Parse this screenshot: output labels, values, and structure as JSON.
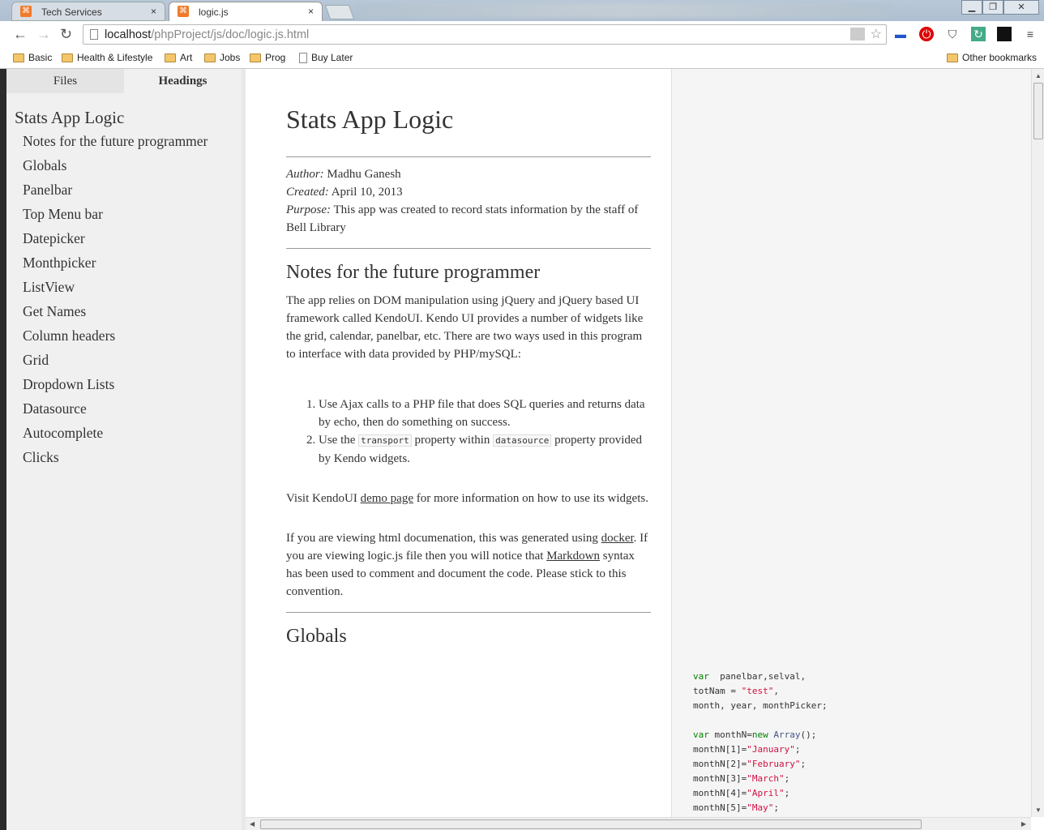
{
  "browser": {
    "tabs": [
      {
        "label": "Tech Services",
        "close": "×"
      },
      {
        "label": "logic.js",
        "close": "×"
      }
    ],
    "url_host": "localhost",
    "url_path": "/phpProject/js/doc/logic.js.html",
    "bookmarks": [
      "Basic",
      "Health & Lifestyle",
      "Art",
      "Jobs",
      "Prog",
      "Buy Later"
    ],
    "other_bookmarks": "Other bookmarks"
  },
  "sidebar": {
    "tabs": [
      "Files",
      "Headings"
    ],
    "title": "Stats App Logic",
    "items": [
      "Notes for the future programmer",
      "Globals",
      "Panelbar",
      "Top Menu bar",
      "Datepicker",
      "Monthpicker",
      "ListView",
      "Get Names",
      "Column headers",
      "Grid",
      "Dropdown Lists",
      "Datasource",
      "Autocomplete",
      "Clicks"
    ]
  },
  "doc": {
    "title": "Stats App Logic",
    "author_label": "Author:",
    "author": "Madhu Ganesh",
    "created_label": "Created:",
    "created": "April 10, 2013",
    "purpose_label": "Purpose:",
    "purpose": "This app was created to record stats information by the staff of Bell Library",
    "h_notes": "Notes for the future programmer",
    "notes_p": "The app relies on DOM manipulation using jQuery and jQuery based UI framework called KendoUI. Kendo UI provides a number of widgets like the grid, calendar, panelbar, etc. There are two ways used in this program to interface with data provided by PHP/mySQL:",
    "li1": "Use Ajax calls to a PHP file that does SQL queries and returns data by echo, then do something on success.",
    "li2_a": "Use the ",
    "li2_code1": "transport",
    "li2_b": " property within ",
    "li2_code2": "datasource",
    "li2_c": " property provided by Kendo widgets.",
    "visit_a": "Visit KendoUI ",
    "visit_link": "demo page",
    "visit_b": " for more information on how to use its widgets.",
    "view_a": "If you are viewing html documenation, this was generated using ",
    "view_link1": "docker",
    "view_b": ". If you are viewing logic.js file then you will notice that ",
    "view_link2": "Markdown",
    "view_c": " syntax has been used to comment and document the code. Please stick to this convention.",
    "h_globals": "Globals"
  },
  "code": {
    "lines": [
      [
        [
          "kw",
          "var"
        ],
        [
          "",
          "  panelbar,selval,"
        ]
      ],
      [
        [
          "",
          "totNam = "
        ],
        [
          "str",
          "\"test\""
        ],
        [
          "",
          ","
        ]
      ],
      [
        [
          "",
          "month, year, monthPicker;"
        ]
      ],
      [
        [
          "",
          ""
        ]
      ],
      [
        [
          "kw",
          "var"
        ],
        [
          "",
          " monthN="
        ],
        [
          "kw",
          "new"
        ],
        [
          "",
          " "
        ],
        [
          "fn",
          "Array"
        ],
        [
          "",
          "();"
        ]
      ],
      [
        [
          "",
          "monthN[1]="
        ],
        [
          "str",
          "\"January\""
        ],
        [
          "",
          ";"
        ]
      ],
      [
        [
          "",
          "monthN[2]="
        ],
        [
          "str",
          "\"February\""
        ],
        [
          "",
          ";"
        ]
      ],
      [
        [
          "",
          "monthN[3]="
        ],
        [
          "str",
          "\"March\""
        ],
        [
          "",
          ";"
        ]
      ],
      [
        [
          "",
          "monthN[4]="
        ],
        [
          "str",
          "\"April\""
        ],
        [
          "",
          ";"
        ]
      ],
      [
        [
          "",
          "monthN[5]="
        ],
        [
          "str",
          "\"May\""
        ],
        [
          "",
          ";"
        ]
      ]
    ]
  }
}
